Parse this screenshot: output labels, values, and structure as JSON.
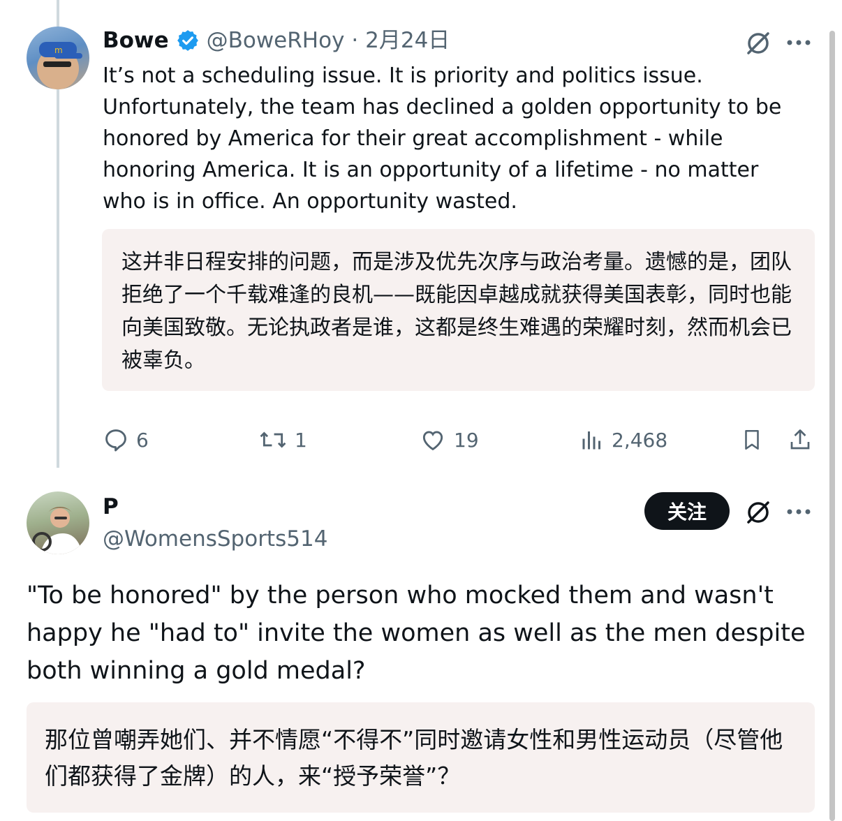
{
  "tweet1": {
    "name": "Bowe",
    "handle": "@BoweRHoy",
    "date": "· 2月24日",
    "text": "It’s not a scheduling issue. It is priority and politics issue. Unfortunately, the team has declined a golden opportunity to be honored by America for their great accomplishment - while honoring America. It is an opportunity of a lifetime - no matter who is in office. An opportunity wasted.",
    "translation": "这并非日程安排的问题，而是涉及优先次序与政治考量。遗憾的是，团队拒绝了一个千载难逢的良机——既能因卓越成就获得美国表彰，同时也能向美国致敬。无论执政者是谁，这都是终生难遇的荣耀时刻，然而机会已被辜负。",
    "stats": {
      "replies": "6",
      "retweets": "1",
      "likes": "19",
      "views": "2,468"
    }
  },
  "tweet2": {
    "name": "P",
    "handle": "@WomensSports514",
    "follow_label": "关注",
    "text": "\"To be honored\" by the person who mocked them and wasn't happy he \"had to\" invite the women as well as the men despite both winning a gold medal?",
    "translation": "那位曾嘲弄她们、并不情愿“不得不”同时邀请女性和男性运动员（尽管他们都获得了金牌）的人，来“授予荣誉”？"
  },
  "colors": {
    "text": "#0f1419",
    "secondary": "#536471",
    "verified": "#1d9bf0",
    "translation_bg": "#f7f1f0",
    "thread_line": "#cfd9de"
  },
  "icons": [
    "verified-badge-icon",
    "grok-icon",
    "more-icon",
    "reply-icon",
    "retweet-icon",
    "like-icon",
    "views-icon",
    "bookmark-icon",
    "share-icon"
  ]
}
